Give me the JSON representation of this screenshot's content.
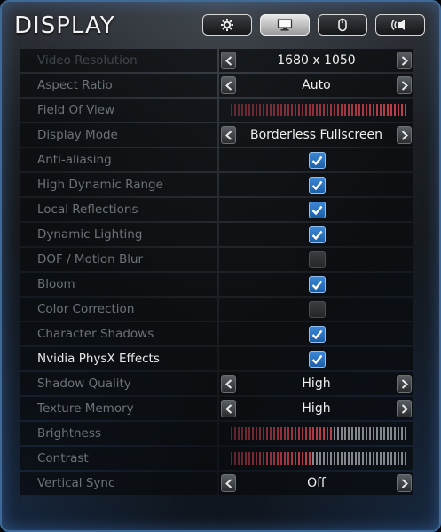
{
  "title": "DISPLAY",
  "tabs": [
    {
      "icon": "gear-icon",
      "active": false
    },
    {
      "icon": "monitor-icon",
      "active": true
    },
    {
      "icon": "mouse-icon",
      "active": false
    },
    {
      "icon": "speaker-icon",
      "active": false
    }
  ],
  "colors": {
    "slider_filled": "#c2404e",
    "slider_empty": "#9a9ea2",
    "checkbox_on": "#2f78c6",
    "frame_border": "#3e6a9a"
  },
  "settings": [
    {
      "label": "Video Resolution",
      "type": "selector",
      "value": "1680 x 1050",
      "label_style": "dim"
    },
    {
      "label": "Aspect Ratio",
      "type": "selector",
      "value": "Auto"
    },
    {
      "label": "Field Of View",
      "type": "slider",
      "fill": 1.0
    },
    {
      "label": "Display Mode",
      "type": "selector",
      "value": "Borderless Fullscreen"
    },
    {
      "label": "Anti-aliasing",
      "type": "checkbox",
      "checked": true
    },
    {
      "label": "High Dynamic Range",
      "type": "checkbox",
      "checked": true
    },
    {
      "label": "Local Reflections",
      "type": "checkbox",
      "checked": true
    },
    {
      "label": "Dynamic Lighting",
      "type": "checkbox",
      "checked": true
    },
    {
      "label": "DOF / Motion Blur",
      "type": "checkbox",
      "checked": false
    },
    {
      "label": "Bloom",
      "type": "checkbox",
      "checked": true
    },
    {
      "label": "Color Correction",
      "type": "checkbox",
      "checked": false
    },
    {
      "label": "Character Shadows",
      "type": "checkbox",
      "checked": true
    },
    {
      "label": "Nvidia PhysX Effects",
      "type": "checkbox",
      "checked": true,
      "label_style": "bright"
    },
    {
      "label": "Shadow Quality",
      "type": "selector",
      "value": "High"
    },
    {
      "label": "Texture Memory",
      "type": "selector",
      "value": "High"
    },
    {
      "label": "Brightness",
      "type": "slider",
      "fill": 0.58
    },
    {
      "label": "Contrast",
      "type": "slider",
      "fill": 0.46
    },
    {
      "label": "Vertical Sync",
      "type": "selector",
      "value": "Off"
    }
  ]
}
